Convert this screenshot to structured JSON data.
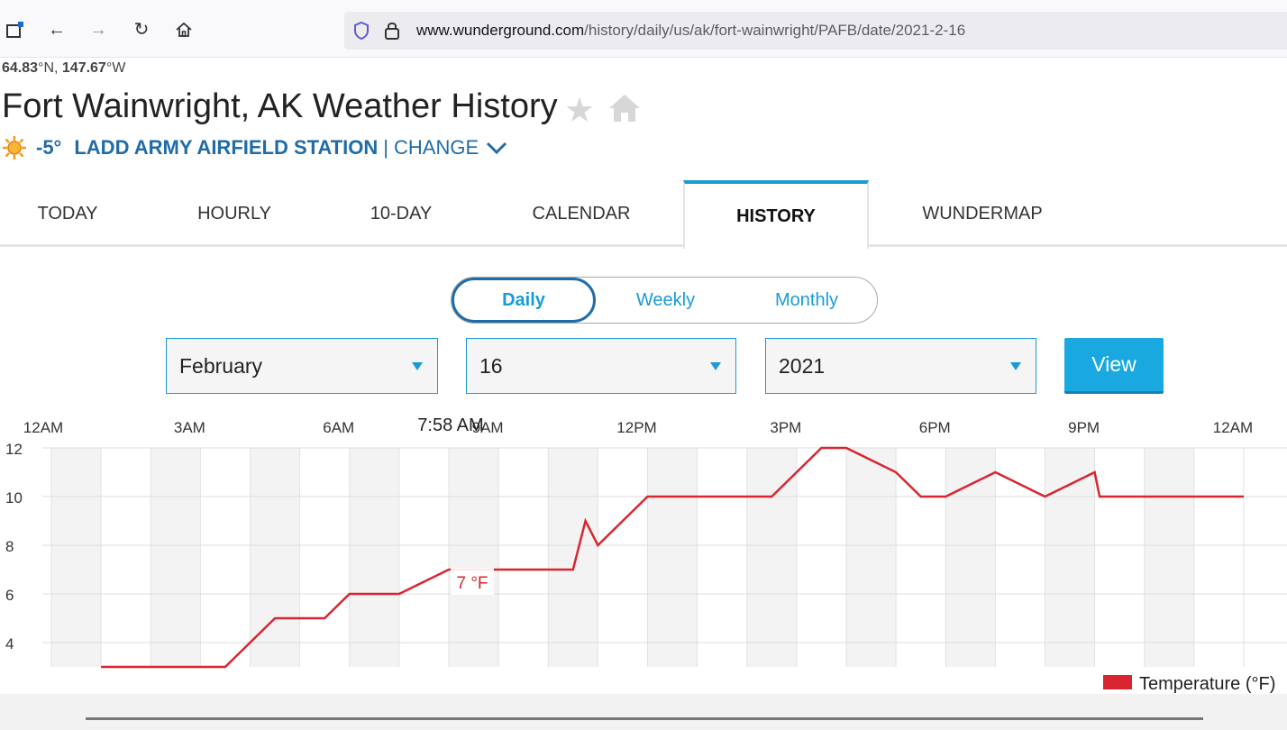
{
  "browser": {
    "url_host": "www.wunderground.com",
    "url_path": "/history/daily/us/ak/fort-wainwright/PAFB/date/2021-2-16",
    "icons": [
      "tab-icon",
      "back-icon",
      "forward-icon",
      "reload-icon",
      "home-icon",
      "shield-icon",
      "lock-icon"
    ]
  },
  "header": {
    "lat": "64.83",
    "lat_unit": "°N, ",
    "lon": "147.67",
    "lon_unit": "°W",
    "title": "Fort Wainwright, AK Weather History",
    "current_temp": "-5°",
    "station": "LADD ARMY AIRFIELD STATION",
    "separator": "|",
    "change_label": "CHANGE"
  },
  "tabs": [
    {
      "label": "TODAY"
    },
    {
      "label": "HOURLY"
    },
    {
      "label": "10-DAY"
    },
    {
      "label": "CALENDAR"
    },
    {
      "label": "HISTORY",
      "active": true
    },
    {
      "label": "WUNDERMAP"
    }
  ],
  "period": {
    "options": [
      "Daily",
      "Weekly",
      "Monthly"
    ],
    "selected": "Daily"
  },
  "filters": {
    "month": "February",
    "day": "16",
    "year": "2021",
    "view_label": "View"
  },
  "colors": {
    "accent": "#1a9ad6",
    "brand_blue": "#1f6ca8",
    "temperature_line": "#d9252f"
  },
  "chart_data": {
    "type": "line",
    "x_tick_labels": [
      "12AM",
      "3AM",
      "6AM",
      "9AM",
      "12PM",
      "3PM",
      "6PM",
      "9PM",
      "12AM"
    ],
    "y_ticks": [
      4,
      6,
      8,
      10,
      12
    ],
    "ylim": [
      3,
      12
    ],
    "xlim_hours": [
      0,
      24
    ],
    "tooltip_time": "7:58 AM",
    "tooltip_value": "7 °F",
    "legend": "Temperature (°F)",
    "series": [
      {
        "name": "Temperature (°F)",
        "x_hours": [
          1,
          2,
          3,
          3.5,
          4,
          4.5,
          5,
          5.5,
          6,
          6.5,
          7,
          7.5,
          8,
          8.5,
          9,
          9.5,
          10,
          10.5,
          10.75,
          11,
          11.5,
          12,
          12.5,
          13,
          13.5,
          14,
          14.5,
          15,
          15.5,
          16,
          16.5,
          17,
          17.5,
          18,
          18.5,
          19,
          19.5,
          20,
          20.5,
          21,
          21.1,
          21.5,
          22,
          22.5,
          23,
          23.5,
          24
        ],
        "values": [
          3,
          3,
          3,
          3,
          4,
          5,
          5,
          5,
          6,
          6,
          6,
          6.5,
          7,
          7,
          7,
          7,
          7,
          7,
          9,
          8,
          9,
          10,
          10,
          10,
          10,
          10,
          10,
          11,
          12,
          12,
          11.5,
          11,
          10,
          10,
          10.5,
          11,
          10.5,
          10,
          10.5,
          11,
          10,
          10,
          10,
          10,
          10,
          10,
          10
        ]
      }
    ]
  }
}
